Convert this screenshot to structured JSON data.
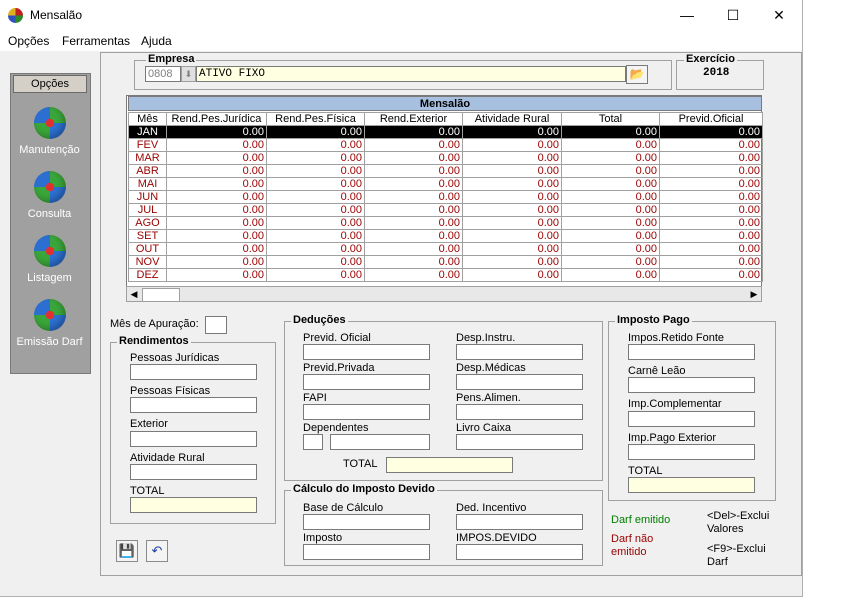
{
  "window": {
    "title": "Mensalão",
    "minimize": "—",
    "maximize": "☐",
    "close": "✕"
  },
  "menu": {
    "items": [
      "Opções",
      "Ferramentas",
      "Ajuda"
    ]
  },
  "sidebar": {
    "title": "Opções",
    "items": [
      {
        "label": "Manutenção",
        "icon": "globe-icon"
      },
      {
        "label": "Consulta",
        "icon": "globe-icon"
      },
      {
        "label": "Listagem",
        "icon": "globe-icon"
      },
      {
        "label": "Emissão Darf",
        "icon": "globe-icon"
      }
    ]
  },
  "empresa": {
    "label": "Empresa",
    "code": "0808",
    "name": "ATIVO FIXO"
  },
  "exercicio": {
    "label": "Exercício",
    "year": "2018"
  },
  "grid": {
    "title": "Mensalão",
    "columns": [
      "Mês",
      "Rend.Pes.Jurídica",
      "Rend.Pes.Física",
      "Rend.Exterior",
      "Atividade Rural",
      "Total",
      "Previd.Oficial"
    ],
    "rows": [
      [
        "JAN",
        "0.00",
        "0.00",
        "0.00",
        "0.00",
        "0.00",
        "0.00"
      ],
      [
        "FEV",
        "0.00",
        "0.00",
        "0.00",
        "0.00",
        "0.00",
        "0.00"
      ],
      [
        "MAR",
        "0.00",
        "0.00",
        "0.00",
        "0.00",
        "0.00",
        "0.00"
      ],
      [
        "ABR",
        "0.00",
        "0.00",
        "0.00",
        "0.00",
        "0.00",
        "0.00"
      ],
      [
        "MAI",
        "0.00",
        "0.00",
        "0.00",
        "0.00",
        "0.00",
        "0.00"
      ],
      [
        "JUN",
        "0.00",
        "0.00",
        "0.00",
        "0.00",
        "0.00",
        "0.00"
      ],
      [
        "JUL",
        "0.00",
        "0.00",
        "0.00",
        "0.00",
        "0.00",
        "0.00"
      ],
      [
        "AGO",
        "0.00",
        "0.00",
        "0.00",
        "0.00",
        "0.00",
        "0.00"
      ],
      [
        "SET",
        "0.00",
        "0.00",
        "0.00",
        "0.00",
        "0.00",
        "0.00"
      ],
      [
        "OUT",
        "0.00",
        "0.00",
        "0.00",
        "0.00",
        "0.00",
        "0.00"
      ],
      [
        "NOV",
        "0.00",
        "0.00",
        "0.00",
        "0.00",
        "0.00",
        "0.00"
      ],
      [
        "DEZ",
        "0.00",
        "0.00",
        "0.00",
        "0.00",
        "0.00",
        "0.00"
      ]
    ],
    "selected_row": 0
  },
  "form": {
    "mes_apuracao": "Mês de Apuração:",
    "rendimentos": {
      "title": "Rendimentos",
      "fields": [
        "Pessoas Jurídicas",
        "Pessoas Físicas",
        "Exterior",
        "Atividade Rural",
        "TOTAL"
      ]
    },
    "deducoes": {
      "title": "Deduções",
      "left": [
        "Previd. Oficial",
        "Previd.Privada",
        "FAPI",
        "Dependentes"
      ],
      "right": [
        "Desp.Instru.",
        "Desp.Médicas",
        "Pens.Alimen.",
        "Livro Caixa"
      ],
      "total": "TOTAL"
    },
    "calculo": {
      "title": "Cálculo do Imposto Devido",
      "fields": [
        "Base de Cálculo",
        "Ded. Incentivo",
        "Imposto",
        "IMPOS.DEVIDO"
      ]
    },
    "imposto_pago": {
      "title": "Imposto Pago",
      "fields": [
        "Impos.Retido  Fonte",
        "Carnê Leão",
        "Imp.Complementar",
        "Imp.Pago Exterior",
        "TOTAL"
      ]
    },
    "legend": {
      "darf_emitido": "Darf emitido",
      "darf_nao_emitido": "Darf não emitido",
      "del_hint": "<Del>-Exclui Valores",
      "f9_hint": "<F9>-Exclui Darf",
      "color_emitido": "#008000",
      "color_nao_emitido": "#9a0000"
    }
  }
}
